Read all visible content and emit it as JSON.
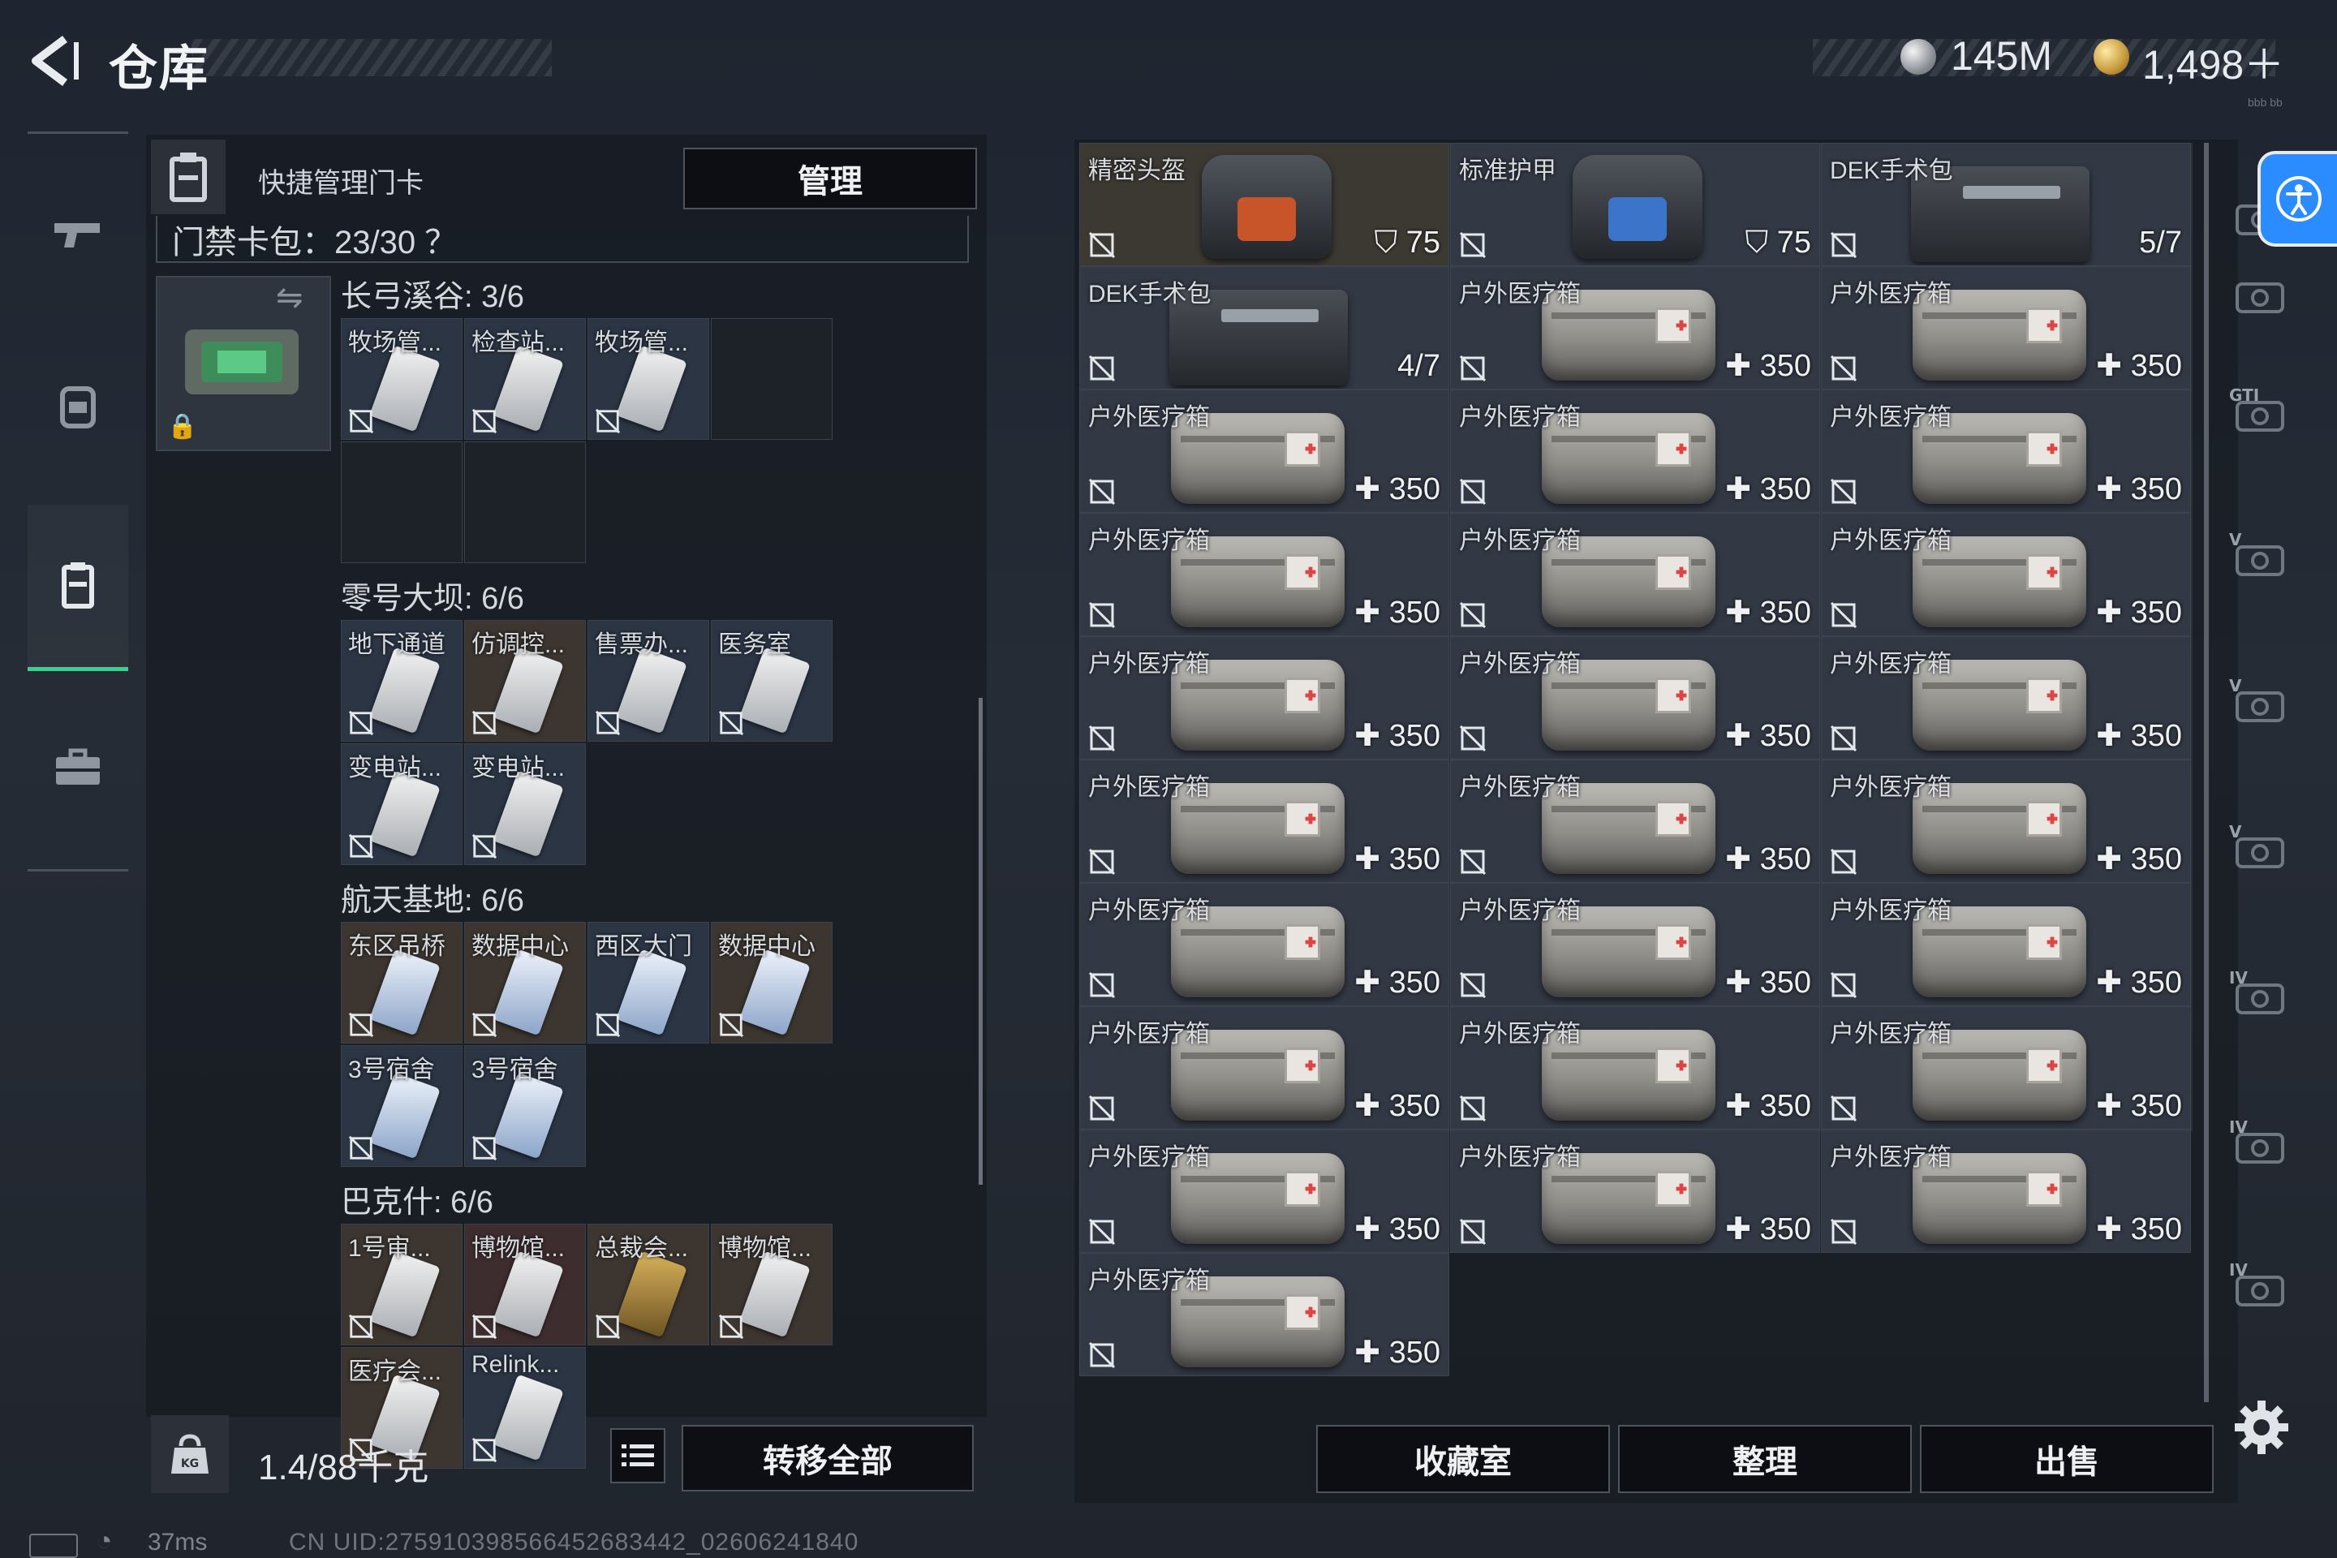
{
  "header": {
    "title": "仓库",
    "currencies": [
      {
        "icon": "silver-coin-icon",
        "value": "145M"
      },
      {
        "icon": "gold-coin-icon",
        "value": "1,498＋"
      }
    ],
    "version_text": "bbb bb"
  },
  "left_nav": [
    {
      "icon": "gun-icon"
    },
    {
      "icon": "backpack-icon"
    },
    {
      "icon": "keycard-holder-icon",
      "active": true
    },
    {
      "icon": "briefcase-icon"
    }
  ],
  "keycard_panel": {
    "quick_label": "快捷管理门卡",
    "manage_button": "管理",
    "card_pack_label": "门禁卡包：23/30 ？",
    "groups": [
      {
        "title": "长弓溪谷: 3/6",
        "cards": [
          "牧场管...",
          "检查站...",
          "牧场管...",
          "",
          "",
          ""
        ]
      },
      {
        "title": "零号大坝: 6/6",
        "cards": [
          "地下通道",
          "仿调控...",
          "售票办...",
          "医务室",
          "变电站...",
          "变电站..."
        ]
      },
      {
        "title": "航天基地: 6/6",
        "cards": [
          "东区吊桥",
          "数据中心",
          "西区大门",
          "数据中心",
          "3号宿舍",
          "3号宿舍"
        ]
      },
      {
        "title": "巴克什: 6/6",
        "cards": [
          "1号审...",
          "博物馆...",
          "总裁会...",
          "博物馆...",
          "医疗会...",
          "Relink..."
        ]
      }
    ],
    "weight_text": "1.4/88千克",
    "transfer_all_button": "转移全部"
  },
  "stash": {
    "items": [
      {
        "name": "精密头盔",
        "value": "75",
        "kind": "helmet-orange"
      },
      {
        "name": "标准护甲",
        "value": "75",
        "kind": "helmet-blue"
      },
      {
        "name": "DEK手术包",
        "value": "5/7",
        "kind": "kit"
      },
      {
        "name": "DEK手术包",
        "value": "4/7",
        "kind": "kit"
      },
      {
        "name": "户外医疗箱",
        "value": "350",
        "kind": "bag"
      },
      {
        "name": "户外医疗箱",
        "value": "350",
        "kind": "bag"
      },
      {
        "name": "户外医疗箱",
        "value": "350",
        "kind": "bag"
      },
      {
        "name": "户外医疗箱",
        "value": "350",
        "kind": "bag"
      },
      {
        "name": "户外医疗箱",
        "value": "350",
        "kind": "bag"
      },
      {
        "name": "户外医疗箱",
        "value": "350",
        "kind": "bag"
      },
      {
        "name": "户外医疗箱",
        "value": "350",
        "kind": "bag"
      },
      {
        "name": "户外医疗箱",
        "value": "350",
        "kind": "bag"
      },
      {
        "name": "户外医疗箱",
        "value": "350",
        "kind": "bag"
      },
      {
        "name": "户外医疗箱",
        "value": "350",
        "kind": "bag"
      },
      {
        "name": "户外医疗箱",
        "value": "350",
        "kind": "bag"
      },
      {
        "name": "户外医疗箱",
        "value": "350",
        "kind": "bag"
      },
      {
        "name": "户外医疗箱",
        "value": "350",
        "kind": "bag"
      },
      {
        "name": "户外医疗箱",
        "value": "350",
        "kind": "bag"
      },
      {
        "name": "户外医疗箱",
        "value": "350",
        "kind": "bag"
      },
      {
        "name": "户外医疗箱",
        "value": "350",
        "kind": "bag"
      },
      {
        "name": "户外医疗箱",
        "value": "350",
        "kind": "bag"
      },
      {
        "name": "户外医疗箱",
        "value": "350",
        "kind": "bag"
      },
      {
        "name": "户外医疗箱",
        "value": "350",
        "kind": "bag"
      },
      {
        "name": "户外医疗箱",
        "value": "350",
        "kind": "bag"
      },
      {
        "name": "户外医疗箱",
        "value": "350",
        "kind": "bag"
      },
      {
        "name": "户外医疗箱",
        "value": "350",
        "kind": "bag"
      },
      {
        "name": "户外医疗箱",
        "value": "350",
        "kind": "bag"
      },
      {
        "name": "户外医疗箱",
        "value": "350",
        "kind": "bag"
      }
    ],
    "buttons": {
      "collection": "收藏室",
      "organize": "整理",
      "sell": "出售"
    }
  },
  "side_strip": [
    {
      "icon": "helmet-slot-icon"
    },
    {
      "icon": "gun-slot-icon"
    },
    {
      "icon": "gti-slot-icon",
      "label": "GTI"
    },
    {
      "icon": "v-case-icon",
      "label": "V"
    },
    {
      "icon": "v-case-icon",
      "label": "V"
    },
    {
      "icon": "v-case-icon",
      "label": "V"
    },
    {
      "icon": "medical-iv-icon",
      "label": "IV"
    },
    {
      "icon": "medical-iv-icon",
      "label": "IV"
    },
    {
      "icon": "iv-folder-icon",
      "label": "IV"
    }
  ],
  "status_bar": {
    "ping": "37ms",
    "uid": "CN UID:275910398566452683442_02606241840"
  },
  "colors": {
    "accent_green": "#3bd08f",
    "accessibility_blue": "#2a8cff"
  }
}
